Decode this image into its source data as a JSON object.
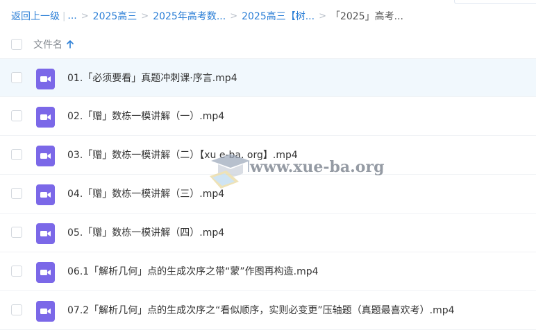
{
  "breadcrumb": {
    "back": "返回上一级",
    "ellipsis": "...",
    "crumbs": [
      "2025高三",
      "2025年高考数...",
      "2025高三【树..."
    ],
    "current": "「2025」高考..."
  },
  "header": {
    "column_name": "文件名",
    "sort_icon": "arrow-up-icon"
  },
  "files": [
    {
      "name": "01.「必须要看」真题冲刺课·序言.mp4",
      "icon": "video-icon"
    },
    {
      "name": "02.「赠」数栋一模讲解（一）.mp4",
      "icon": "video-icon"
    },
    {
      "name": "03.「赠」数栋一模讲解（二）【xu e-ba. org】.mp4",
      "icon": "video-icon"
    },
    {
      "name": "04.「赠」数栋一模讲解（三）.mp4",
      "icon": "video-icon"
    },
    {
      "name": "05.「赠」数栋一模讲解（四）.mp4",
      "icon": "video-icon"
    },
    {
      "name": "06.1「解析几何」点的生成次序之带“蒙”作图再构造.mp4",
      "icon": "video-icon"
    },
    {
      "name": "07.2「解析几何」点的生成次序之“看似顺序，实则必变更”压轴题（真题最喜欢考）.mp4",
      "icon": "video-icon"
    }
  ],
  "watermark": {
    "text": "www.xue-ba.org"
  },
  "colors": {
    "link": "#2a7ed6",
    "video_icon": "#7b68e8",
    "row_hover": "#f1f8fd"
  }
}
